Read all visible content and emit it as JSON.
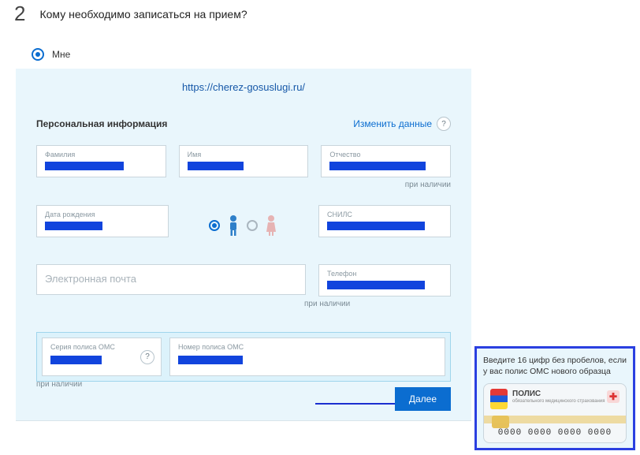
{
  "step": {
    "number": "2",
    "title": "Кому необходимо записаться на прием?"
  },
  "radio": {
    "me_label": "Мне"
  },
  "watermark_url": "https://cherez-gosuslugi.ru/",
  "section_title": "Персональная информация",
  "change_link": "Изменить данные",
  "hints": {
    "optional": "при наличии"
  },
  "fields": {
    "surname": "Фамилия",
    "name": "Имя",
    "patronymic": "Отчество",
    "birthdate": "Дата рождения",
    "snils": "СНИЛС",
    "email_placeholder": "Электронная почта",
    "phone": "Телефон",
    "polis_series": "Серия полиса ОМС",
    "polis_number": "Номер полиса ОМС"
  },
  "next_button": "Далее",
  "tooltip": {
    "text": "Введите 16 цифр без пробелов, если у вас полис ОМС нового образца",
    "polis_title": "ПОЛИС",
    "polis_subtitle": "обязательного медицинского страхования",
    "polis_digits": "0000 0000 0000 0000"
  }
}
